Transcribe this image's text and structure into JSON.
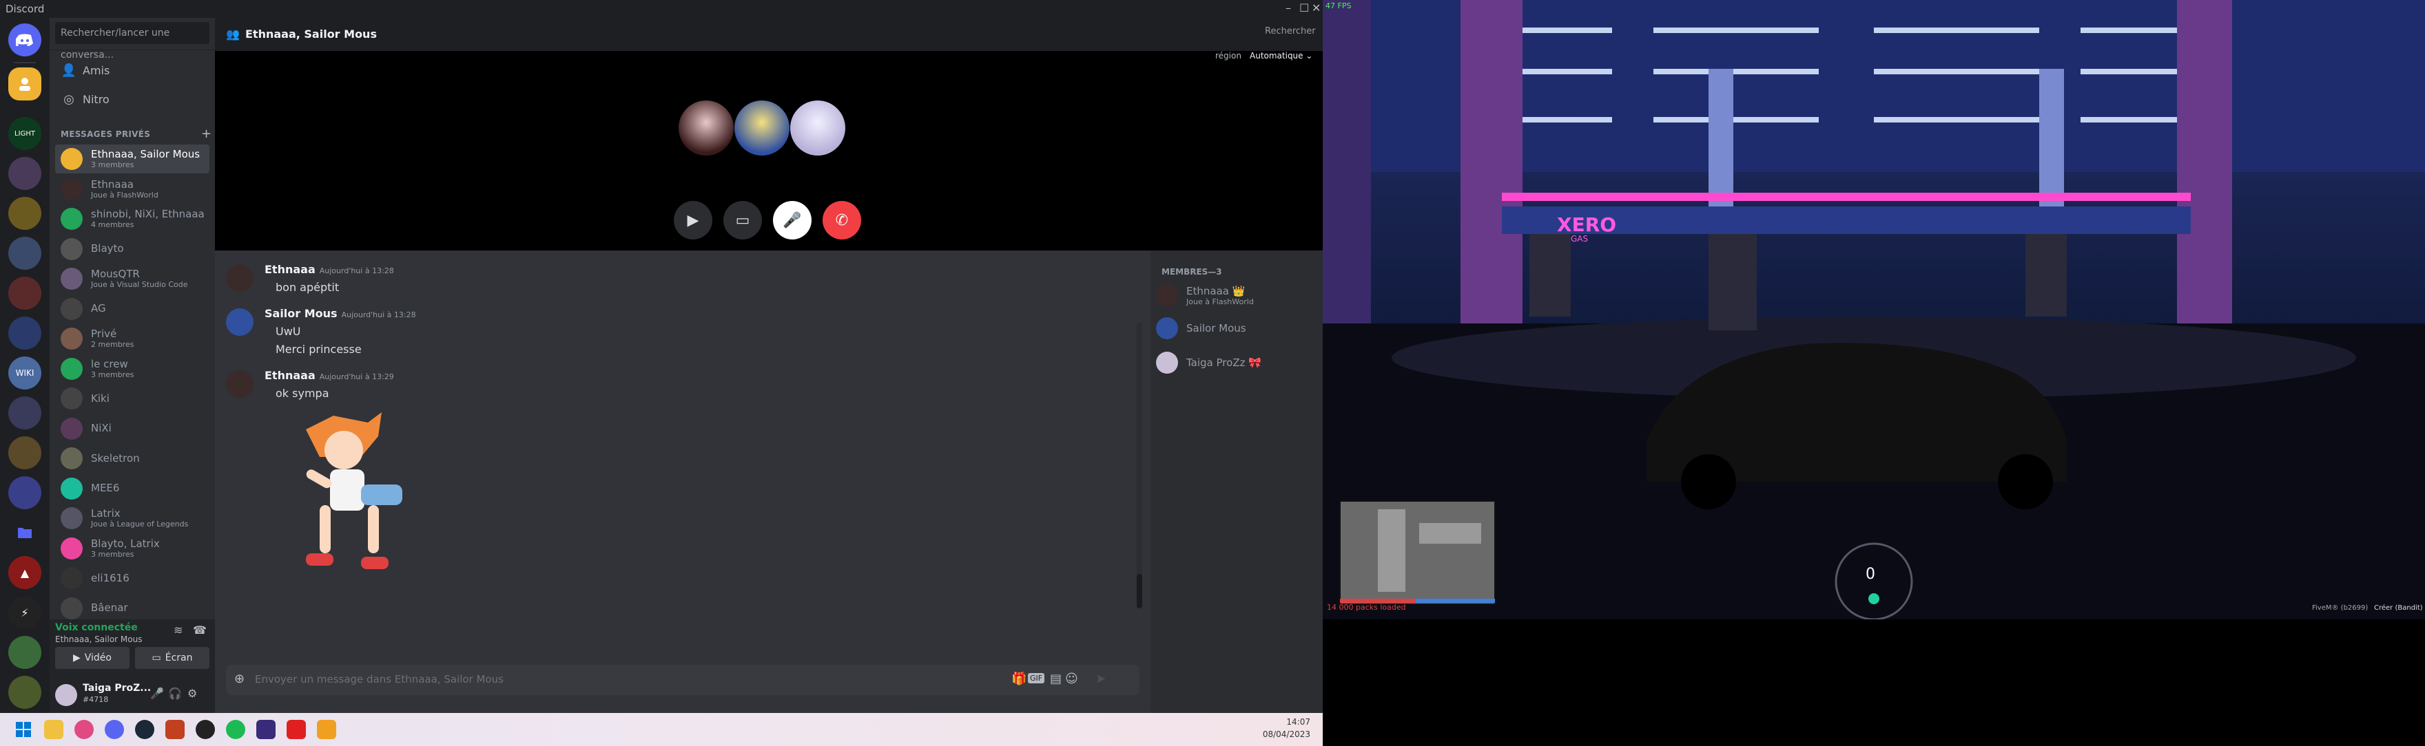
{
  "discord": {
    "title": "Discord",
    "search_placeholder": "Rechercher/lancer une conversa...",
    "nav": [
      {
        "label": "Amis",
        "icon": "friends-icon"
      },
      {
        "label": "Nitro",
        "icon": "nitro-icon"
      }
    ],
    "dm_header": "MESSAGES PRIVÉS",
    "dm_list": [
      {
        "name": "Ethnaaa, Sailor Mous",
        "sub": "3 membres",
        "color": "#f0b232",
        "selected": true
      },
      {
        "name": "Ethnaaa",
        "sub": "Joue à FlashWorld",
        "color": "#3a2a2a"
      },
      {
        "name": "shinobi, NiXi, Ethnaaa",
        "sub": "4 membres",
        "color": "#23a55a"
      },
      {
        "name": "Blayto",
        "sub": "",
        "color": "#555"
      },
      {
        "name": "MousQTR",
        "sub": "Joue à Visual Studio Code",
        "color": "#6a5a7a"
      },
      {
        "name": "AG",
        "sub": "",
        "color": "#444"
      },
      {
        "name": "Privé",
        "sub": "2 membres",
        "color": "#7a5a4a"
      },
      {
        "name": "le crew",
        "sub": "3 membres",
        "color": "#23a55a"
      },
      {
        "name": "Kiki",
        "sub": "",
        "color": "#444"
      },
      {
        "name": "NiXi",
        "sub": "",
        "color": "#5a3a5a"
      },
      {
        "name": "Skeletron",
        "sub": "",
        "color": "#665"
      },
      {
        "name": "MEE6",
        "sub": "",
        "color": "#1abc9c"
      },
      {
        "name": "Latrix",
        "sub": "Joue à League of Legends",
        "color": "#556"
      },
      {
        "name": "Blayto, Latrix",
        "sub": "3 membres",
        "color": "#eb459e"
      },
      {
        "name": "eli1616",
        "sub": "",
        "color": "#333"
      },
      {
        "name": "Bâenar",
        "sub": "",
        "color": "#444"
      }
    ],
    "voice": {
      "status": "Voix connectée",
      "channel": "Ethnaaa, Sailor Mous",
      "video_label": "Vidéo",
      "screen_label": "Écran"
    },
    "user": {
      "name": "Taiga ProZ...",
      "tag": "#4718"
    },
    "channel": {
      "name": "Ethnaaa, Sailor Mous",
      "search_placeholder": "Rechercher",
      "region_label": "région",
      "region_value": "Automatique"
    },
    "messages": [
      {
        "author": "Ethnaaa",
        "time": "Aujourd'hui à 13:28",
        "lines": [
          "bon apéptit"
        ]
      },
      {
        "author": "Sailor Mous",
        "time": "Aujourd'hui à 13:28",
        "lines": [
          "UwU",
          "Merci princesse"
        ]
      },
      {
        "author": "Ethnaaa",
        "time": "Aujourd'hui à 13:29",
        "lines": [
          "ok sympa"
        ]
      }
    ],
    "composer_placeholder": "Envoyer un message dans Ethnaaa, Sailor Mous",
    "members_header": "MEMBRES—3",
    "members": [
      {
        "name": "Ethnaaa",
        "sub": "Joue à FlashWorld",
        "badge": "👑"
      },
      {
        "name": "Sailor Mous",
        "sub": "",
        "badge": ""
      },
      {
        "name": "Taiga ProZz",
        "sub": "",
        "badge": "🎀"
      }
    ]
  },
  "taskbar": {
    "time": "14:07",
    "date": "08/04/2023"
  },
  "game": {
    "fps": "47 FPS",
    "speed": "0",
    "notice": "14 000 packs loaded",
    "watermark": "FiveM® (b2699)",
    "watermark_right": "Créer (Bandit)",
    "brand": "XERO",
    "brand_sub": "GAS"
  }
}
